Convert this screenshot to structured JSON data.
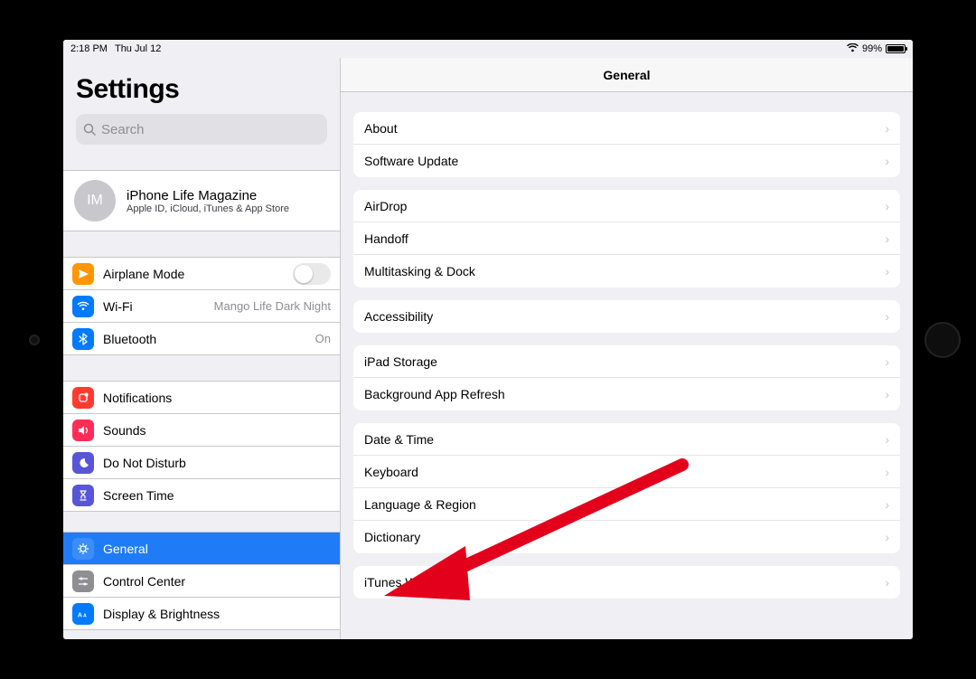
{
  "statusbar": {
    "time": "2:18 PM",
    "date": "Thu Jul 12",
    "battery_pct": "99%"
  },
  "sidebar": {
    "title": "Settings",
    "search_placeholder": "Search",
    "account": {
      "initials": "IM",
      "name": "iPhone Life Magazine",
      "subtitle": "Apple ID, iCloud, iTunes & App Store"
    },
    "group1": {
      "airplane": "Airplane Mode",
      "wifi": "Wi-Fi",
      "wifi_value": "Mango Life Dark Night",
      "bluetooth": "Bluetooth",
      "bluetooth_value": "On"
    },
    "group2": {
      "notifications": "Notifications",
      "sounds": "Sounds",
      "dnd": "Do Not Disturb",
      "screen_time": "Screen Time"
    },
    "group3": {
      "general": "General",
      "control_center": "Control Center",
      "display": "Display & Brightness"
    },
    "icon_colors": {
      "airplane": "#ff9500",
      "wifi": "#007aff",
      "bluetooth": "#007aff",
      "notifications": "#ff3b30",
      "sounds": "#ff2d55",
      "dnd": "#5856d6",
      "screen_time": "#5856d6",
      "general": "#8e8e93",
      "control_center": "#8e8e93",
      "display": "#007aff"
    }
  },
  "detail": {
    "header": "General",
    "sections": [
      [
        "About",
        "Software Update"
      ],
      [
        "AirDrop",
        "Handoff",
        "Multitasking & Dock"
      ],
      [
        "Accessibility"
      ],
      [
        "iPad Storage",
        "Background App Refresh"
      ],
      [
        "Date & Time",
        "Keyboard",
        "Language & Region",
        "Dictionary"
      ],
      [
        "iTunes Wi-Fi Sync"
      ]
    ]
  }
}
